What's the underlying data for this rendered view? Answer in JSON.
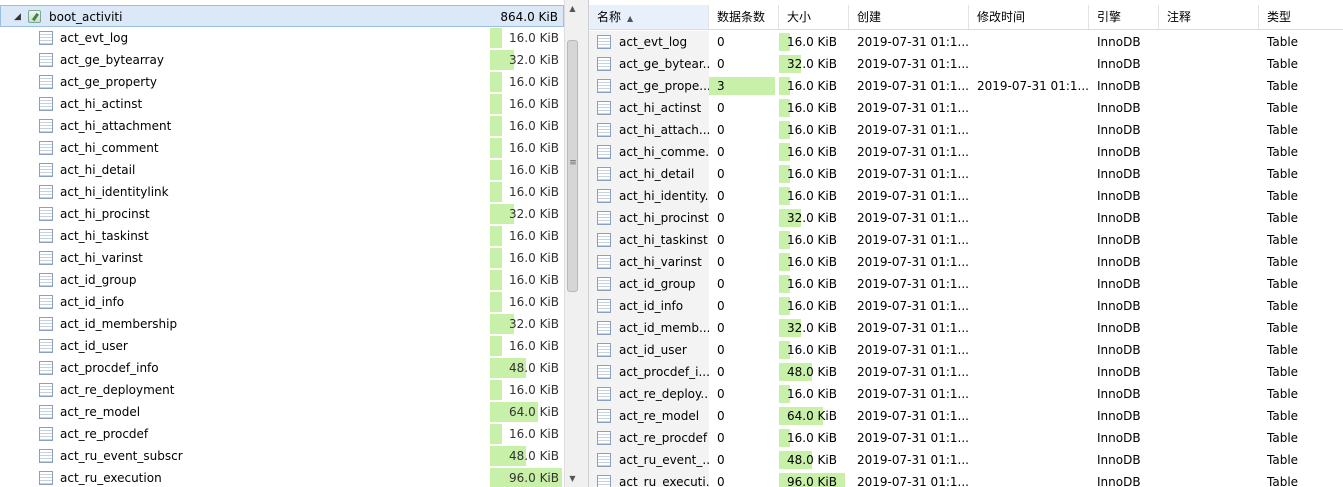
{
  "tree": {
    "root": {
      "name": "boot_activiti",
      "size": "864.0 KiB"
    },
    "items": [
      {
        "name": "act_evt_log",
        "size": "16.0 KiB",
        "fill": 0.167
      },
      {
        "name": "act_ge_bytearray",
        "size": "32.0 KiB",
        "fill": 0.333
      },
      {
        "name": "act_ge_property",
        "size": "16.0 KiB",
        "fill": 0.167
      },
      {
        "name": "act_hi_actinst",
        "size": "16.0 KiB",
        "fill": 0.167
      },
      {
        "name": "act_hi_attachment",
        "size": "16.0 KiB",
        "fill": 0.167
      },
      {
        "name": "act_hi_comment",
        "size": "16.0 KiB",
        "fill": 0.167
      },
      {
        "name": "act_hi_detail",
        "size": "16.0 KiB",
        "fill": 0.167
      },
      {
        "name": "act_hi_identitylink",
        "size": "16.0 KiB",
        "fill": 0.167
      },
      {
        "name": "act_hi_procinst",
        "size": "32.0 KiB",
        "fill": 0.333
      },
      {
        "name": "act_hi_taskinst",
        "size": "16.0 KiB",
        "fill": 0.167
      },
      {
        "name": "act_hi_varinst",
        "size": "16.0 KiB",
        "fill": 0.167
      },
      {
        "name": "act_id_group",
        "size": "16.0 KiB",
        "fill": 0.167
      },
      {
        "name": "act_id_info",
        "size": "16.0 KiB",
        "fill": 0.167
      },
      {
        "name": "act_id_membership",
        "size": "32.0 KiB",
        "fill": 0.333
      },
      {
        "name": "act_id_user",
        "size": "16.0 KiB",
        "fill": 0.167
      },
      {
        "name": "act_procdef_info",
        "size": "48.0 KiB",
        "fill": 0.5
      },
      {
        "name": "act_re_deployment",
        "size": "16.0 KiB",
        "fill": 0.167
      },
      {
        "name": "act_re_model",
        "size": "64.0 KiB",
        "fill": 0.667
      },
      {
        "name": "act_re_procdef",
        "size": "16.0 KiB",
        "fill": 0.167
      },
      {
        "name": "act_ru_event_subscr",
        "size": "48.0 KiB",
        "fill": 0.5
      },
      {
        "name": "act_ru_execution",
        "size": "96.0 KiB",
        "fill": 1.0
      }
    ]
  },
  "grid": {
    "columns": [
      "名称",
      "数据条数",
      "大小",
      "创建",
      "修改时间",
      "引擎",
      "注释",
      "类型"
    ],
    "sort_indicator": "▲",
    "rows": [
      {
        "name": "act_evt_log",
        "rows": "0",
        "rows_fill": 0,
        "size": "16.0 KiB",
        "size_fill": 0.167,
        "created": "2019-07-31 01:1...",
        "modified": "",
        "engine": "InnoDB",
        "comment": "",
        "type": "Table"
      },
      {
        "name": "act_ge_bytear...",
        "rows": "0",
        "rows_fill": 0,
        "size": "32.0 KiB",
        "size_fill": 0.333,
        "created": "2019-07-31 01:1...",
        "modified": "",
        "engine": "InnoDB",
        "comment": "",
        "type": "Table"
      },
      {
        "name": "act_ge_prope...",
        "rows": "3",
        "rows_fill": 1.0,
        "size": "16.0 KiB",
        "size_fill": 0.167,
        "created": "2019-07-31 01:1...",
        "modified": "2019-07-31 01:1...",
        "engine": "InnoDB",
        "comment": "",
        "type": "Table"
      },
      {
        "name": "act_hi_actinst",
        "rows": "0",
        "rows_fill": 0,
        "size": "16.0 KiB",
        "size_fill": 0.167,
        "created": "2019-07-31 01:1...",
        "modified": "",
        "engine": "InnoDB",
        "comment": "",
        "type": "Table"
      },
      {
        "name": "act_hi_attach...",
        "rows": "0",
        "rows_fill": 0,
        "size": "16.0 KiB",
        "size_fill": 0.167,
        "created": "2019-07-31 01:1...",
        "modified": "",
        "engine": "InnoDB",
        "comment": "",
        "type": "Table"
      },
      {
        "name": "act_hi_comme...",
        "rows": "0",
        "rows_fill": 0,
        "size": "16.0 KiB",
        "size_fill": 0.167,
        "created": "2019-07-31 01:1...",
        "modified": "",
        "engine": "InnoDB",
        "comment": "",
        "type": "Table"
      },
      {
        "name": "act_hi_detail",
        "rows": "0",
        "rows_fill": 0,
        "size": "16.0 KiB",
        "size_fill": 0.167,
        "created": "2019-07-31 01:1...",
        "modified": "",
        "engine": "InnoDB",
        "comment": "",
        "type": "Table"
      },
      {
        "name": "act_hi_identity...",
        "rows": "0",
        "rows_fill": 0,
        "size": "16.0 KiB",
        "size_fill": 0.167,
        "created": "2019-07-31 01:1...",
        "modified": "",
        "engine": "InnoDB",
        "comment": "",
        "type": "Table"
      },
      {
        "name": "act_hi_procinst",
        "rows": "0",
        "rows_fill": 0,
        "size": "32.0 KiB",
        "size_fill": 0.333,
        "created": "2019-07-31 01:1...",
        "modified": "",
        "engine": "InnoDB",
        "comment": "",
        "type": "Table"
      },
      {
        "name": "act_hi_taskinst",
        "rows": "0",
        "rows_fill": 0,
        "size": "16.0 KiB",
        "size_fill": 0.167,
        "created": "2019-07-31 01:1...",
        "modified": "",
        "engine": "InnoDB",
        "comment": "",
        "type": "Table"
      },
      {
        "name": "act_hi_varinst",
        "rows": "0",
        "rows_fill": 0,
        "size": "16.0 KiB",
        "size_fill": 0.167,
        "created": "2019-07-31 01:1...",
        "modified": "",
        "engine": "InnoDB",
        "comment": "",
        "type": "Table"
      },
      {
        "name": "act_id_group",
        "rows": "0",
        "rows_fill": 0,
        "size": "16.0 KiB",
        "size_fill": 0.167,
        "created": "2019-07-31 01:1...",
        "modified": "",
        "engine": "InnoDB",
        "comment": "",
        "type": "Table"
      },
      {
        "name": "act_id_info",
        "rows": "0",
        "rows_fill": 0,
        "size": "16.0 KiB",
        "size_fill": 0.167,
        "created": "2019-07-31 01:1...",
        "modified": "",
        "engine": "InnoDB",
        "comment": "",
        "type": "Table"
      },
      {
        "name": "act_id_memb...",
        "rows": "0",
        "rows_fill": 0,
        "size": "32.0 KiB",
        "size_fill": 0.333,
        "created": "2019-07-31 01:1...",
        "modified": "",
        "engine": "InnoDB",
        "comment": "",
        "type": "Table"
      },
      {
        "name": "act_id_user",
        "rows": "0",
        "rows_fill": 0,
        "size": "16.0 KiB",
        "size_fill": 0.167,
        "created": "2019-07-31 01:1...",
        "modified": "",
        "engine": "InnoDB",
        "comment": "",
        "type": "Table"
      },
      {
        "name": "act_procdef_i...",
        "rows": "0",
        "rows_fill": 0,
        "size": "48.0 KiB",
        "size_fill": 0.5,
        "created": "2019-07-31 01:1...",
        "modified": "",
        "engine": "InnoDB",
        "comment": "",
        "type": "Table"
      },
      {
        "name": "act_re_deploy...",
        "rows": "0",
        "rows_fill": 0,
        "size": "16.0 KiB",
        "size_fill": 0.167,
        "created": "2019-07-31 01:1...",
        "modified": "",
        "engine": "InnoDB",
        "comment": "",
        "type": "Table"
      },
      {
        "name": "act_re_model",
        "rows": "0",
        "rows_fill": 0,
        "size": "64.0 KiB",
        "size_fill": 0.667,
        "created": "2019-07-31 01:1...",
        "modified": "",
        "engine": "InnoDB",
        "comment": "",
        "type": "Table"
      },
      {
        "name": "act_re_procdef",
        "rows": "0",
        "rows_fill": 0,
        "size": "16.0 KiB",
        "size_fill": 0.167,
        "created": "2019-07-31 01:1...",
        "modified": "",
        "engine": "InnoDB",
        "comment": "",
        "type": "Table"
      },
      {
        "name": "act_ru_event_...",
        "rows": "0",
        "rows_fill": 0,
        "size": "48.0 KiB",
        "size_fill": 0.5,
        "created": "2019-07-31 01:1...",
        "modified": "",
        "engine": "InnoDB",
        "comment": "",
        "type": "Table"
      },
      {
        "name": "act_ru_executi...",
        "rows": "0",
        "rows_fill": 0,
        "size": "96.0 KiB",
        "size_fill": 1.0,
        "created": "2019-07-31 01:1...",
        "modified": "",
        "engine": "InnoDB",
        "comment": "",
        "type": "Table"
      }
    ]
  },
  "colors": {
    "bar_fill": "#c8f0a8",
    "selection": "#dbe8f7"
  },
  "icons": {
    "expand": "collapse-arrow-icon",
    "database": "database-icon",
    "table": "table-icon"
  }
}
